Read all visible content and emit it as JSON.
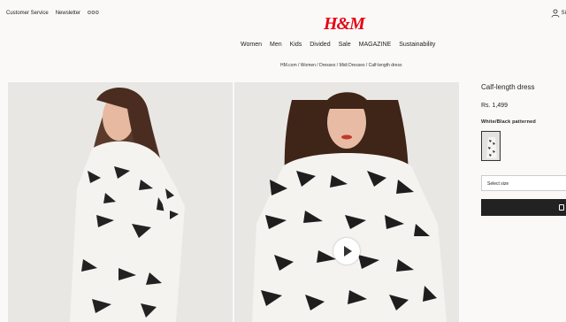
{
  "header": {
    "customer_service": "Customer Service",
    "newsletter": "Newsletter",
    "more": "ooo",
    "logo": "H&M",
    "sign_in": "Si"
  },
  "nav": [
    "Women",
    "Men",
    "Kids",
    "Divided",
    "Sale",
    "MAGAZINE",
    "Sustainability"
  ],
  "breadcrumb": "HM.com / Women / Dresses / Midi Dresses / Calf-length dress",
  "product": {
    "title": "Calf-length dress",
    "price": "Rs. 1,499",
    "color_name": "White/Black patterned",
    "size_placeholder": "Select size"
  },
  "colors": {
    "brand_red": "#e50010",
    "button_dark": "#222222"
  }
}
